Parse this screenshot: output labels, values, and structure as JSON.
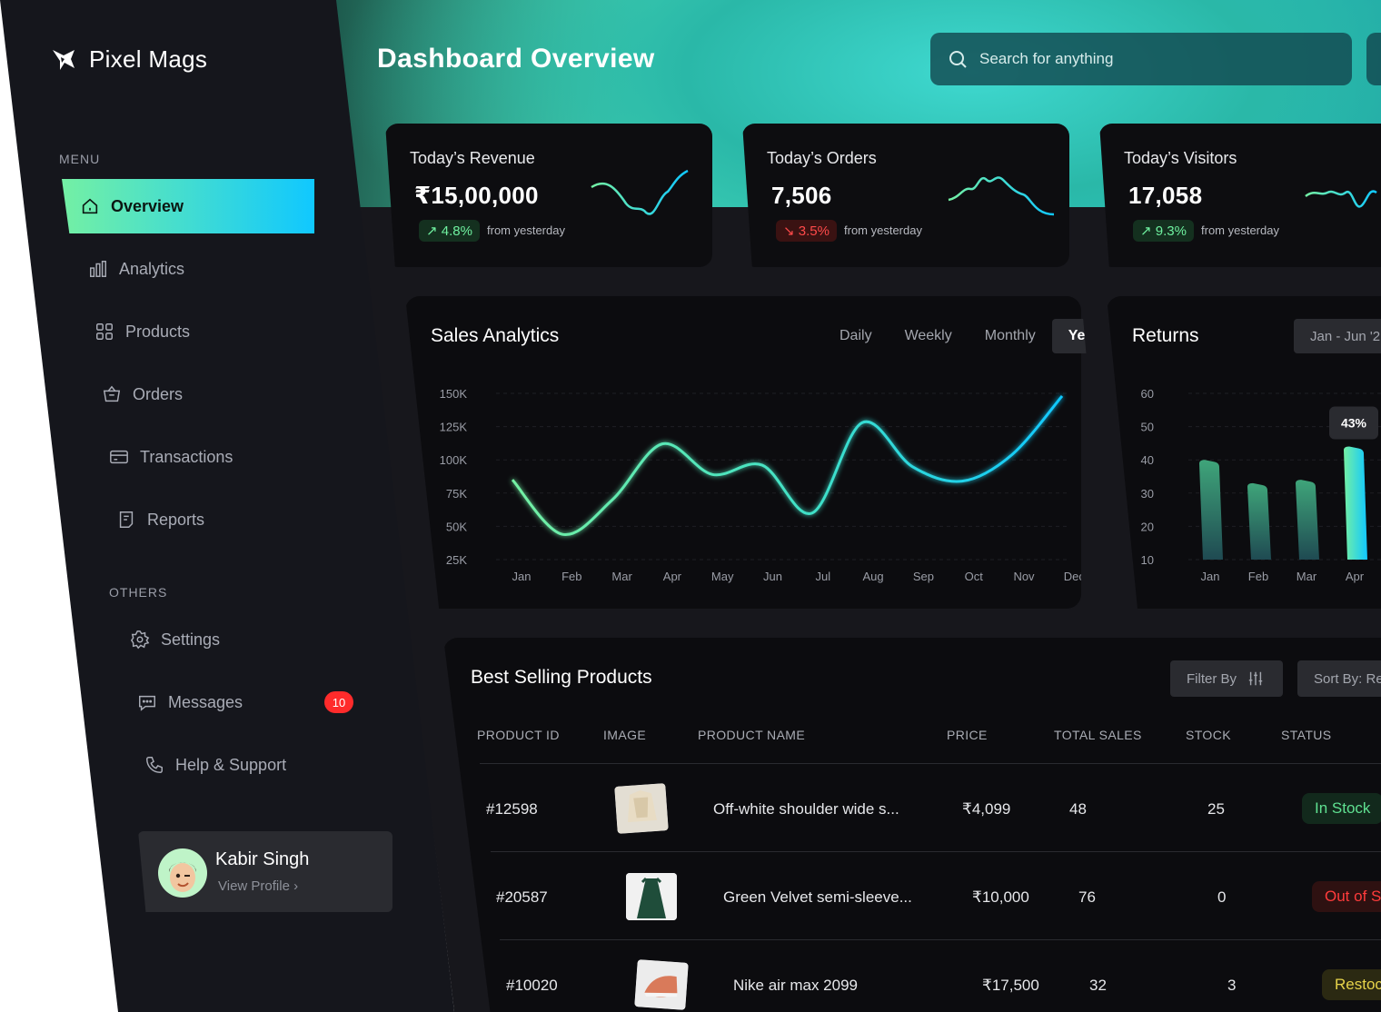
{
  "app": {
    "name": "Pixel Mags"
  },
  "sidebar": {
    "menu_label": "MENU",
    "items": [
      {
        "label": "Overview",
        "icon": "home-icon"
      },
      {
        "label": "Analytics",
        "icon": "bar-chart-icon"
      },
      {
        "label": "Products",
        "icon": "grid-icon"
      },
      {
        "label": "Orders",
        "icon": "basket-icon"
      },
      {
        "label": "Transactions",
        "icon": "card-icon"
      },
      {
        "label": "Reports",
        "icon": "report-icon"
      }
    ],
    "others_label": "OTHERS",
    "others": [
      {
        "label": "Settings",
        "icon": "gear-icon"
      },
      {
        "label": "Messages",
        "icon": "chat-icon",
        "badge": "10"
      },
      {
        "label": "Help & Support",
        "icon": "phone-icon"
      }
    ],
    "profile": {
      "name": "Kabir Singh",
      "link": "View Profile ›"
    }
  },
  "header": {
    "title": "Dashboard Overview",
    "search_placeholder": "Search for anything"
  },
  "stats": [
    {
      "title": "Today’s Revenue",
      "value": "₹15,00,000",
      "change": "↗ 4.8%",
      "direction": "up",
      "note": "from yesterday"
    },
    {
      "title": "Today’s Orders",
      "value": "7,506",
      "change": "↘ 3.5%",
      "direction": "down",
      "note": "from yesterday"
    },
    {
      "title": "Today’s Visitors",
      "value": "17,058",
      "change": "↗ 9.3%",
      "direction": "up",
      "note": "from yesterday"
    }
  ],
  "colors": {
    "accent_green": "#74f0a4",
    "accent_cyan": "#10c8ff",
    "danger": "#ff2b2b"
  },
  "sales": {
    "title": "Sales Analytics",
    "tabs": [
      "Daily",
      "Weekly",
      "Monthly",
      "Yearly"
    ],
    "active_tab": "Yearly"
  },
  "returns": {
    "title": "Returns",
    "range": "Jan - Jun '2",
    "tooltip": "43%"
  },
  "chart_data": [
    {
      "type": "line",
      "categories": [
        "Jan",
        "Feb",
        "Mar",
        "Apr",
        "May",
        "Jun",
        "Jul",
        "Aug",
        "Sep",
        "Oct",
        "Nov",
        "Dec"
      ],
      "values": [
        85000,
        44000,
        70000,
        112000,
        89000,
        96000,
        60000,
        128000,
        95000,
        84000,
        104000,
        148000
      ],
      "yticks": [
        "150K",
        "125K",
        "100K",
        "75K",
        "50K",
        "25K"
      ],
      "ylim": [
        25000,
        150000
      ]
    },
    {
      "type": "bar",
      "categories": [
        "Jan",
        "Feb",
        "Mar",
        "Apr"
      ],
      "values": [
        40,
        33,
        34,
        44
      ],
      "yticks": [
        "60",
        "50",
        "40",
        "30",
        "20",
        "10"
      ],
      "ylim": [
        10,
        60
      ]
    }
  ],
  "products": {
    "title": "Best Selling Products",
    "filter_label": "Filter By",
    "sort_label": "Sort By: Re",
    "columns": [
      "PRODUCT ID",
      "IMAGE",
      "PRODUCT NAME",
      "PRICE",
      "TOTAL SALES",
      "STOCK",
      "STATUS"
    ],
    "rows": [
      {
        "id": "#12598",
        "name": "Off-white shoulder wide s...",
        "price": "₹4,099",
        "sales": "48",
        "stock": "25",
        "status": "In Stock",
        "status_type": "green"
      },
      {
        "id": "#20587",
        "name": "Green Velvet semi-sleeve...",
        "price": "₹10,000",
        "sales": "76",
        "stock": "0",
        "status": "Out of S",
        "status_type": "red"
      },
      {
        "id": "#10020",
        "name": "Nike air max 2099",
        "price": "₹17,500",
        "sales": "32",
        "stock": "3",
        "status": "Restoc",
        "status_type": "yellow"
      }
    ]
  }
}
